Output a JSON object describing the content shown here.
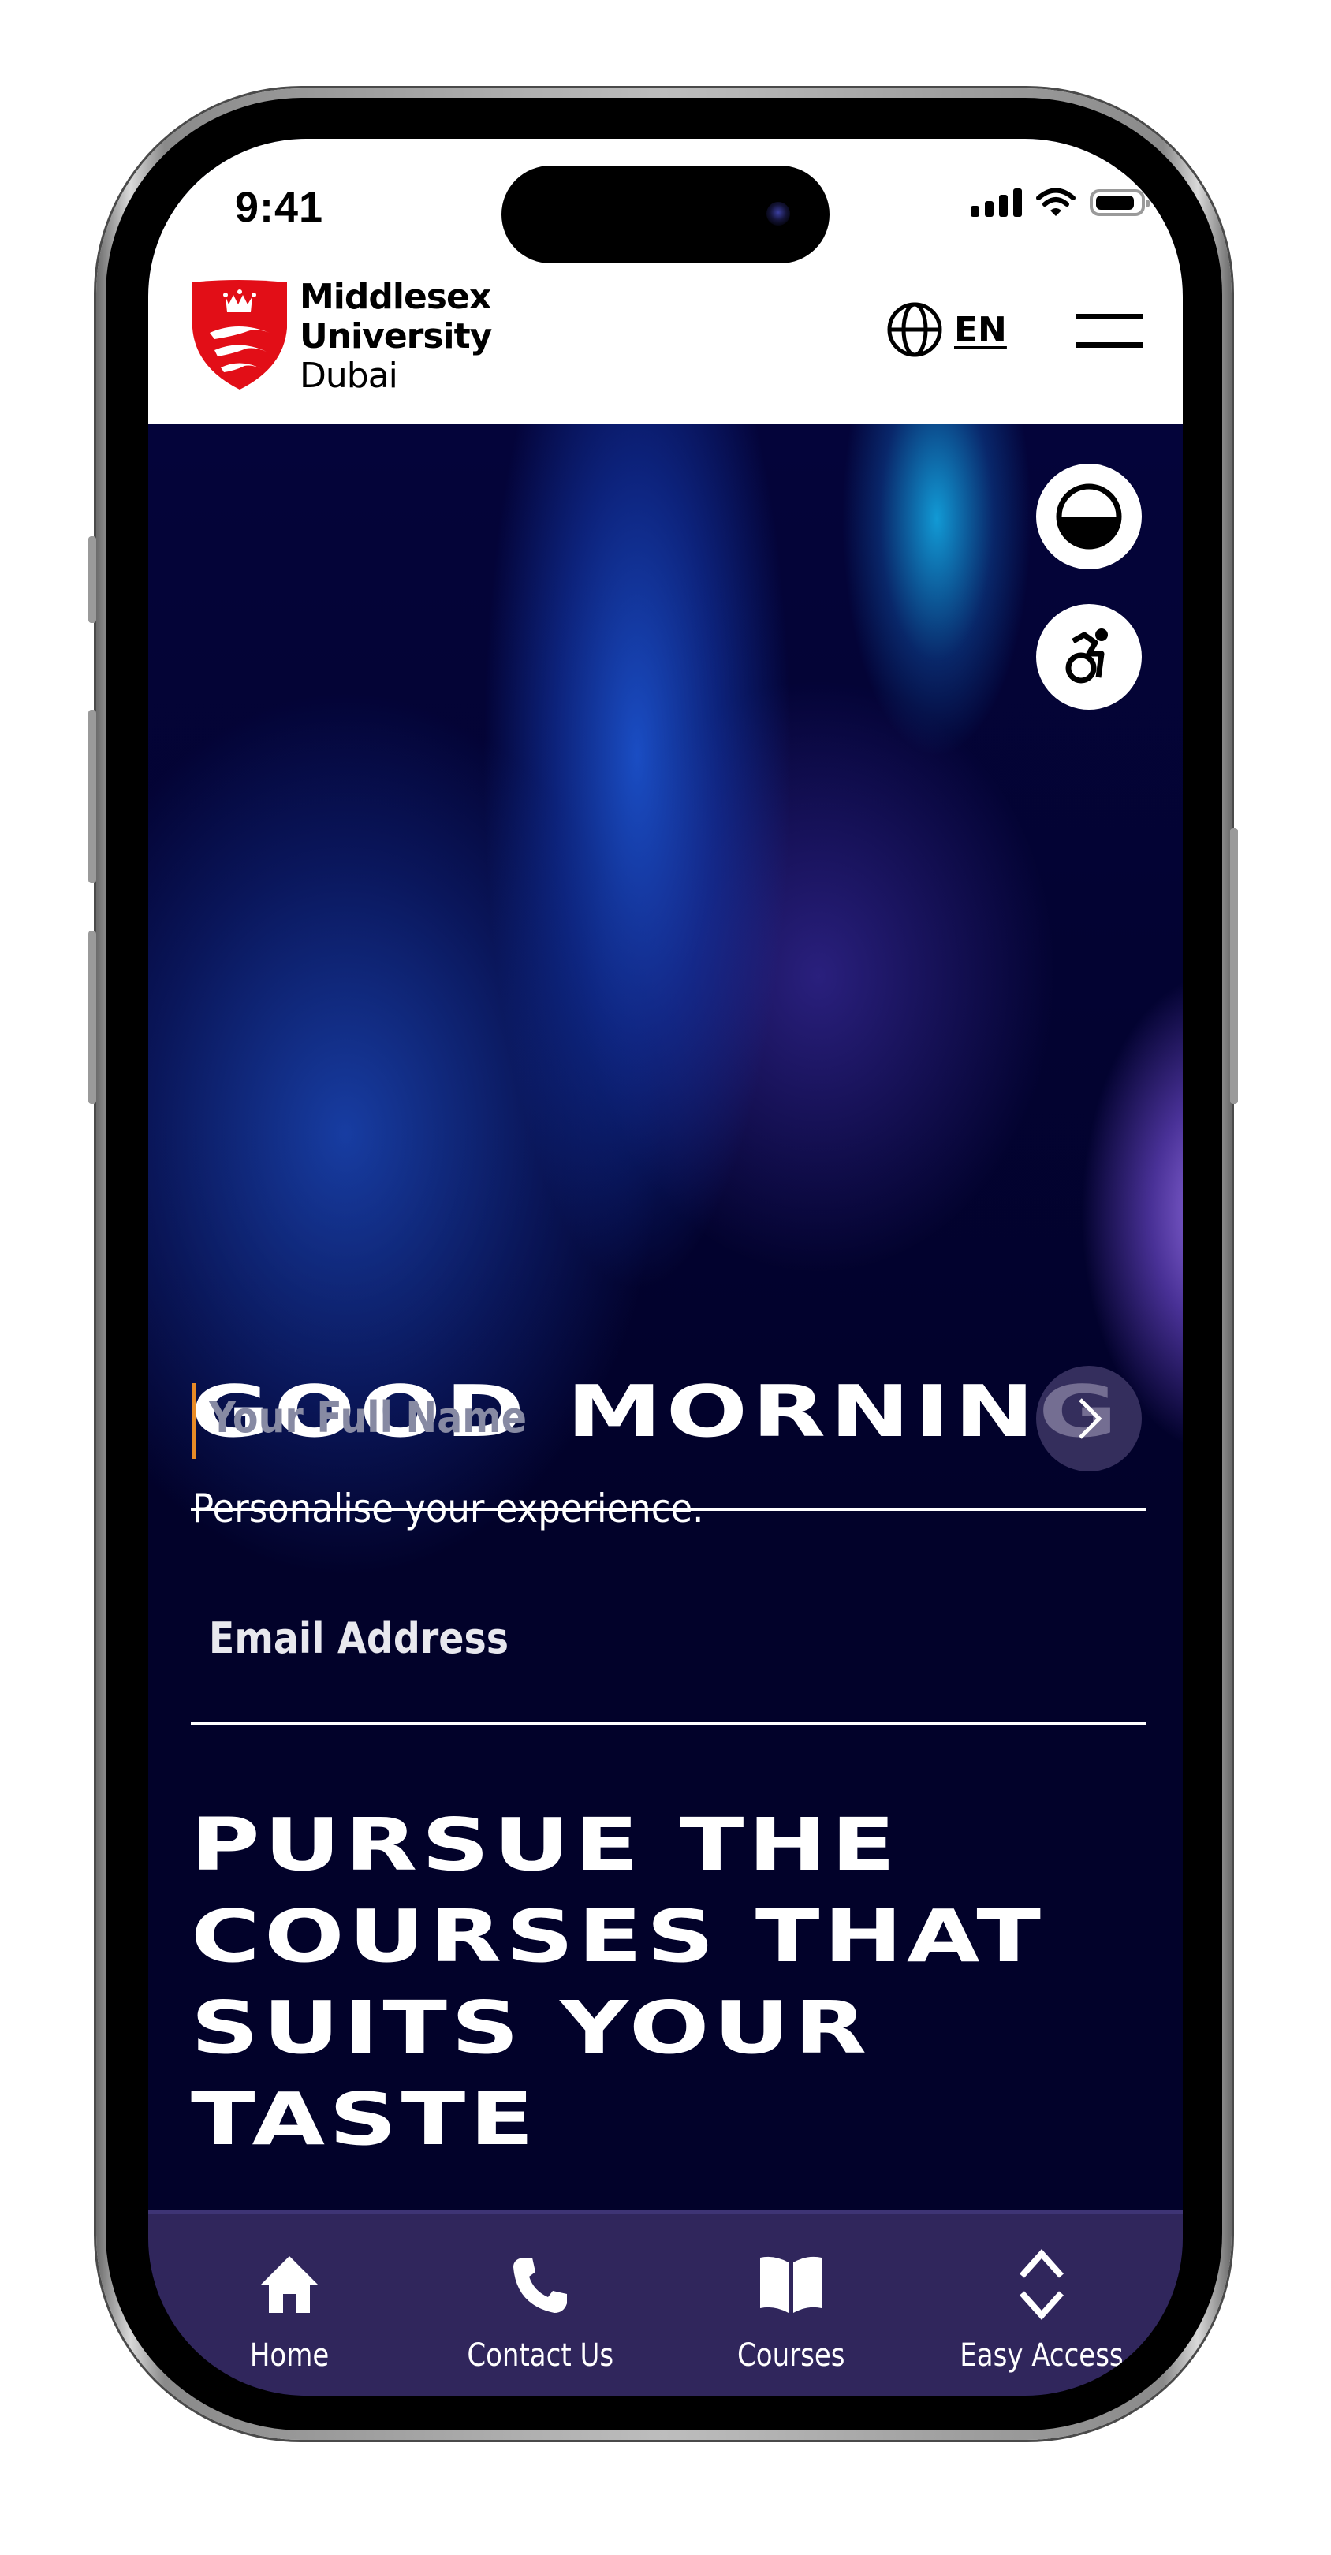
{
  "status_bar": {
    "time": "9:41",
    "icons": [
      "cellular-signal-icon",
      "wifi-icon",
      "battery-icon"
    ]
  },
  "header": {
    "logo": {
      "line1": "Middlesex",
      "line2": "University",
      "line3": "Dubai",
      "shield_color": "#e20e17"
    },
    "language": {
      "icon": "globe-icon",
      "label": "EN"
    },
    "menu_icon": "hamburger-menu-icon"
  },
  "accessibility_buttons": [
    {
      "icon": "contrast-icon",
      "label": "Contrast"
    },
    {
      "icon": "accessibility-wheelchair-icon",
      "label": "Accessibility"
    }
  ],
  "hero": {
    "greeting": "GOOD MORNING",
    "subtitle": "Personalise your experience.",
    "form": {
      "name_placeholder": "Your Full Name",
      "name_value": "",
      "email_placeholder": "Email Address",
      "email_value": "",
      "submit_icon": "chevron-right-icon"
    },
    "headline_lines": [
      "PURSUE THE",
      "COURSES THAT",
      "SUITS YOUR",
      "TASTE"
    ],
    "carousel": {
      "total": 5,
      "active_index": 0
    }
  },
  "bottom_nav": {
    "items": [
      {
        "label": "Home",
        "icon": "home-icon"
      },
      {
        "label": "Contact Us",
        "icon": "phone-icon"
      },
      {
        "label": "Courses",
        "icon": "book-icon"
      },
      {
        "label": "Easy Access",
        "icon": "chevron-up-down-icon"
      }
    ]
  },
  "colors": {
    "hero_bg": "#02022a",
    "nav_bg": "#30265c",
    "caret": "#e88b26",
    "brand_red": "#e20e17"
  }
}
